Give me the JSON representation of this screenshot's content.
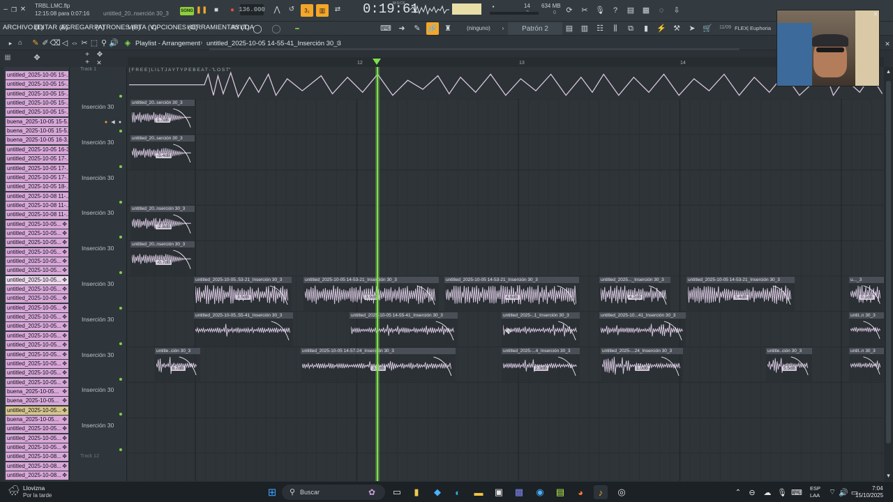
{
  "project": {
    "file_name": "TRBL.LMC.flp",
    "saved_info": "12:15:08 para 0:07:16",
    "pattern_hint": "untitled_20..nserción 30_3",
    "song_badge": "SONG",
    "tempo": "136.000",
    "time_display": "0:19:61",
    "time_mini_label": "M:S:CS",
    "cpu_value": "14",
    "cpu_sub": "3",
    "ram_label": "634 MB",
    "ram_sub": "0"
  },
  "menu": {
    "items": [
      "ARCHIVO (F)",
      "EDITAR (E)",
      "AGREGAR (A)",
      "PATRONES (P)",
      "VISTA (V)",
      "OPCIONES (O)",
      "HERRAMIENTAS (T)",
      "AYUDA"
    ],
    "none_label": "(ninguno)",
    "pattern_label": "Patrón 2",
    "version_label": "11/09",
    "flex_label": "FLEX",
    "preset_label": "Euphoria"
  },
  "playlist": {
    "title": "Playlist - Arrangement",
    "separator": "›",
    "clip_name": "untitled_2025-10-05 14-55-41_Inserción 30_3",
    "bar_markers": [
      "12",
      "13",
      "14"
    ]
  },
  "browser": {
    "items": [
      "untitled_2025-10-05 15-...",
      "untitled_2025-10-05 15-...",
      "untitled_2025-10-05 15-...",
      "untitled_2025-10-05 15-...",
      "untitled_2025-10-05 15-...",
      "buena_2025-10-05 15-5...",
      "buena_2025-10-05 15-5...",
      "buena_2025-10-05 16-3...",
      "untitled_2025-10-05 16-3...",
      "untitled_2025-10-05 17-...",
      "untitled_2025-10-05 17-...",
      "untitled_2025-10-05 17-...",
      "untitled_2025-10-05 18-...",
      "untitled_2025-10-08 11-...",
      "untitled_2025-10-08 11-...",
      "untitled_2025-10-08 11-...",
      "untitled_2025-10-05...",
      "untitled_2025-10-05...",
      "untitled_2025-10-05...",
      "untitled_2025-10-05...",
      "untitled_2025-10-05...",
      "untitled_2025-10-05...",
      "untitled_2025-10-05...",
      "untitled_2025-10-05...",
      "untitled_2025-10-05...",
      "untitled_2025-10-05...",
      "untitled_2025-10-05...",
      "untitled_2025-10-05...",
      "untitled_2025-10-05...",
      "untitled_2025-10-05...",
      "untitled_2025-10-05...",
      "untitled_2025-10-05...",
      "untitled_2025-10-05...",
      "untitled_2025-10-05...",
      "buena_2025-10-05...",
      "buena_2025-10-05...",
      "untitled_2025-10-05...",
      "buena_2025-10-05...",
      "untitled_2025-10-05...",
      "untitled_2025-10-05...",
      "untitled_2025-10-05...",
      "untitled_2025-10-08...",
      "untitled_2025-10-08...",
      "untitled_2025-10-08..."
    ]
  },
  "tracks": {
    "top_label": "Track 1",
    "label": "Inserción 30",
    "bottom_label": "Track 12",
    "count": 10
  },
  "clips": {
    "top": "[ F R E E ] L I L  T J A Y  T Y P E  B E A T  -  \"L O S T\"",
    "c1": {
      "name": "untitled_20..serción 30_3",
      "db": "1.7dB"
    },
    "c2": {
      "name": "untitled_20..serción 30_3",
      "db": "-5.4dB"
    },
    "c3": {
      "name": "untitled_20..nserción 30_3",
      "db": "-2.8dB"
    },
    "c4": {
      "name": "untitled_20..nserción 30_3",
      "db": "-0.7dB"
    },
    "c5": {
      "name": "untitled_2025-10-05..53-21_Inserción 30_3",
      "db": "3.5dB"
    },
    "c6": {
      "name": "untitled_2025-10-05 14-53-21_Inserción 30_3",
      "db": "3.9dB"
    },
    "c7": {
      "name": "untitled_2025-10-05 14-53-21_Inserción 30_3",
      "db": "4.8dB"
    },
    "c8": {
      "name": "untitled_2025..._Inserción 30_3",
      "db": "4.2dB"
    },
    "c9": {
      "name": "untitled_2025-10-05 14-53-21_Inserción 30_3",
      "db": "5.4dB"
    },
    "c10": {
      "name": "u..._3",
      "db": "0.1dB"
    },
    "c11": {
      "name": "untitled_2025-10-05..55-41_Inserción 30_3"
    },
    "c12": {
      "name": "untitled_2025-10-05 14-55-41_Inserción 30_3"
    },
    "c13": {
      "name": "untitled_2025-..1_Inserción 30_3"
    },
    "c14": {
      "name": "untitled_2025-10...41_Inserción 30_3"
    },
    "c15": {
      "name": "untit..n 30_3"
    },
    "c16": {
      "name": "untitle..ción 30_3",
      "db": "8.7dB"
    },
    "c17": {
      "name": "untitled_2025-10-05 14-57-24_Inserción 30_3",
      "db": "3.7dB"
    },
    "c18": {
      "name": "untitled_2025-...4_Inserción 30_3",
      "db": "2.3dB"
    },
    "c19": {
      "name": "untitled_2025-...24_Inserción 30_3",
      "db": "1.0dB"
    },
    "c20": {
      "name": "untitle..ción 30_3",
      "db": "5.5dB"
    },
    "c21": {
      "name": "untit..n 30_3"
    }
  },
  "taskbar": {
    "weather_title": "Llovizna",
    "weather_sub": "Por la tarde",
    "search_placeholder": "Buscar",
    "lang": "ESP",
    "lang_sub": "LAA",
    "clock_time": "7:04",
    "clock_date": "15/10/2025"
  },
  "colors": {
    "accent_orange": "#f4a62a",
    "playhead": "#7fe04b",
    "clip_header": "#4a4f57",
    "wave": "#d8c8e0",
    "browser_pink": "#d8a7d8"
  }
}
